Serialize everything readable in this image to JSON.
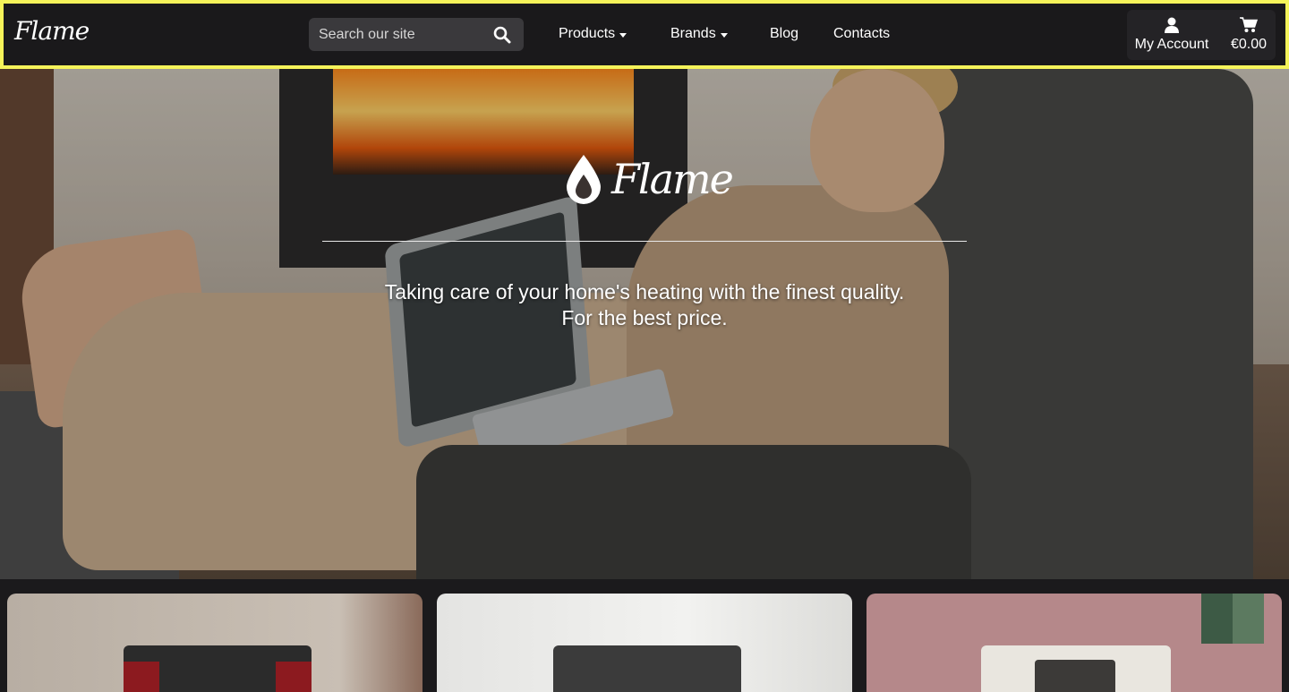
{
  "header": {
    "brand": "Flame",
    "search_placeholder": "Search our site",
    "nav": [
      "Products",
      "Brands",
      "Blog",
      "Contacts"
    ],
    "account_label": "My Account",
    "cart_total": "€0.00"
  },
  "hero": {
    "logo_text": "Flame",
    "tagline_line1": "Taking care of your home's heating with the finest quality.",
    "tagline_line2": "For the best price."
  },
  "colors": {
    "header_bg": "#1a191b",
    "highlight_border": "#f5f35a",
    "search_bg": "#3a393c"
  },
  "icons": [
    "search-icon",
    "user-icon",
    "cart-icon",
    "drop-icon",
    "caret-down-icon"
  ]
}
